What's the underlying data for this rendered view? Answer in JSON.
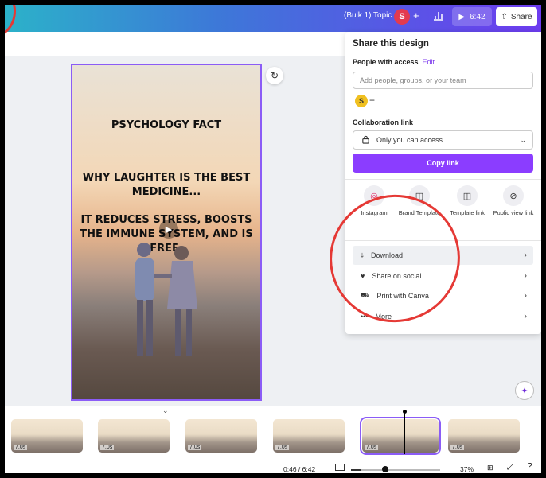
{
  "topbar": {
    "project_title": "(Bulk 1) Topic",
    "avatar_initial": "S",
    "add_label": "+",
    "play_time": "6:42",
    "share_label": "Share"
  },
  "design": {
    "heading": "PSYCHOLOGY FACT",
    "line1": "WHY LAUGHTER IS THE BEST MEDICINE...",
    "line2": "IT REDUCES STRESS, BOOSTS THE IMMUNE SYSTEM, AND IS FREE."
  },
  "share_panel": {
    "title": "Share this design",
    "people_label": "People with access",
    "edit_label": "Edit",
    "input_placeholder": "Add people, groups, or your team",
    "avatar_initial": "S",
    "add_person": "+",
    "collab_label": "Collaboration link",
    "access_value": "Only you can access",
    "copy_label": "Copy link",
    "options": [
      {
        "label": "Instagram",
        "icon": "instagram-icon"
      },
      {
        "label": "Brand Template",
        "icon": "brand-template-icon"
      },
      {
        "label": "Template link",
        "icon": "template-link-icon"
      },
      {
        "label": "Public view link",
        "icon": "link-icon"
      }
    ],
    "rows": [
      {
        "label": "Download",
        "icon": "download-icon"
      },
      {
        "label": "Share on social",
        "icon": "heart-icon"
      },
      {
        "label": "Print with Canva",
        "icon": "truck-icon"
      },
      {
        "label": "More",
        "icon": "more-icon"
      }
    ]
  },
  "timeline": {
    "clip_durations": [
      "7.0s",
      "7.0s",
      "7.0s",
      "7.0s",
      "7.0s",
      "7.0s"
    ],
    "time_readout": "0:46 / 6:42",
    "zoom": "37%",
    "playhead_progress": 0.115
  },
  "colors": {
    "accent": "#8b3dff",
    "annotation_red": "#e53935"
  }
}
